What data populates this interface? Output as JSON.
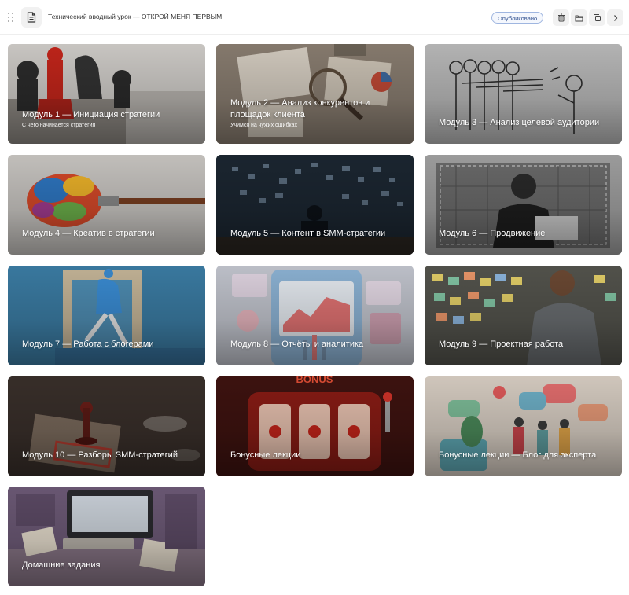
{
  "header": {
    "title": "Технический вводный урок — ОТКРОЙ МЕНЯ ПЕРВЫМ",
    "status": "Опубликовано",
    "icons": [
      "drag-handle-icon",
      "document-icon",
      "trash-icon",
      "folder-icon",
      "copy-icon",
      "chevron-right-icon"
    ]
  },
  "modules": [
    {
      "title": "Модуль 1 — Инициация стратегии",
      "subtitle": "С чего начинается стратегия"
    },
    {
      "title": "Модуль 2 — Анализ конкурентов и площадок клиента",
      "subtitle": "Учимся на чужих ошибках"
    },
    {
      "title": "Модуль 3 — Анализ целевой аудитории",
      "subtitle": ""
    },
    {
      "title": "Модуль 4 — Креатив в стратегии",
      "subtitle": ""
    },
    {
      "title": "Модуль 5 — Контент в SMM-стратегии",
      "subtitle": ""
    },
    {
      "title": "Модуль 6 — Продвижение",
      "subtitle": ""
    },
    {
      "title": "Модуль 7 — Работа с блогерами",
      "subtitle": ""
    },
    {
      "title": "Модуль 8 — Отчёты и аналитика",
      "subtitle": ""
    },
    {
      "title": "Модуль 9 — Проектная работа",
      "subtitle": ""
    },
    {
      "title": "Модуль 10 — Разборы SMM-стратегий",
      "subtitle": ""
    },
    {
      "title": "Бонусные лекции",
      "subtitle": ""
    },
    {
      "title": "Бонусные лекции — Блог для эксперта",
      "subtitle": ""
    },
    {
      "title": "Домашние задания",
      "subtitle": ""
    }
  ],
  "colors": {
    "badge_border": "#9fb6e0",
    "badge_text": "#2f4f8f"
  }
}
